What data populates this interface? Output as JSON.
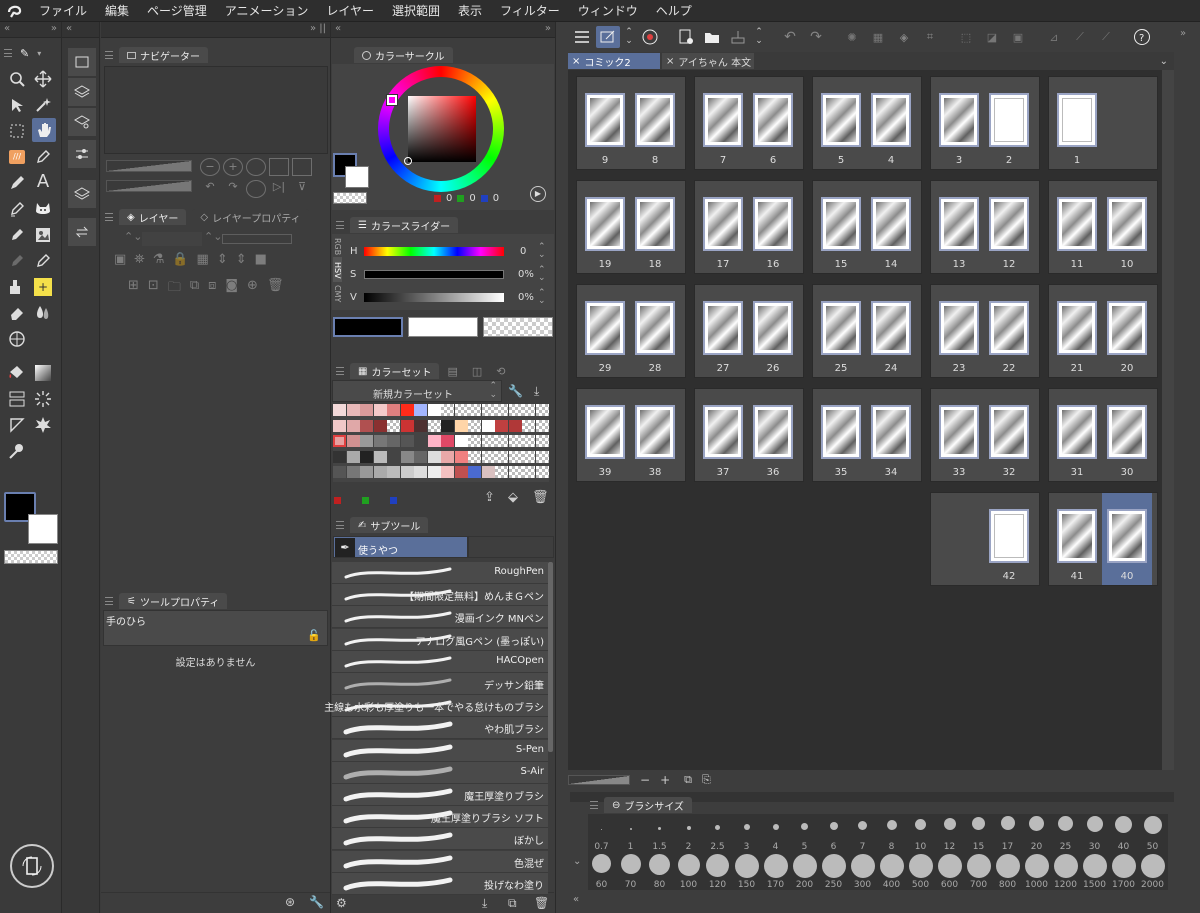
{
  "menubar": {
    "items": [
      "ファイル",
      "編集",
      "ページ管理",
      "アニメーション",
      "レイヤー",
      "選択範囲",
      "表示",
      "フィルター",
      "ウィンドウ",
      "ヘルプ"
    ]
  },
  "navigator": {
    "title": "ナビゲーター"
  },
  "layers": {
    "tab1": "レイヤー",
    "tab2": "レイヤープロパティ"
  },
  "tool_property": {
    "title": "ツールプロパティ",
    "tool_name": "手のひら",
    "empty_text": "設定はありません"
  },
  "color_circle": {
    "title": "カラーサークル",
    "r": "0",
    "g": "0",
    "b": "0"
  },
  "color_slider": {
    "title": "カラースライダー",
    "side_tabs": [
      "RGB",
      "HSV",
      "CMY"
    ],
    "h_label": "H",
    "h_value": "0",
    "s_label": "S",
    "s_value": "0%",
    "v_label": "V",
    "v_value": "0%"
  },
  "color_set": {
    "title": "カラーセット",
    "set_name": "新規カラーセット"
  },
  "subtool": {
    "title": "サブツール",
    "group": "使うやつ",
    "brushes": [
      "RoughPen",
      "【期間限定無料】めんまＧペン",
      "漫画インク MNペン",
      "アナログ風Gペン (墨っぽい)",
      "HACOpen",
      "デッサン鉛筆",
      "主線も水彩も厚塗りも一本でやる怠けものブラシ",
      "やわ肌ブラシ",
      "S-Pen",
      "S-Air",
      "魔王厚塗りブラシ",
      "魔王厚塗りブラシ ソフト",
      "ぼかし",
      "色混ぜ",
      "投げなわ塗り"
    ]
  },
  "document_tabs": [
    {
      "label": "コミック2",
      "active": true
    },
    {
      "label": "アイちゃん 本文",
      "active": false
    }
  ],
  "pages": {
    "rows": [
      [
        [
          "9",
          "8"
        ],
        [
          "7",
          "6"
        ],
        [
          "5",
          "4"
        ],
        [
          "3",
          "2"
        ],
        [
          "1"
        ]
      ],
      [
        [
          "19",
          "18"
        ],
        [
          "17",
          "16"
        ],
        [
          "15",
          "14"
        ],
        [
          "13",
          "12"
        ],
        [
          "11",
          "10"
        ]
      ],
      [
        [
          "29",
          "28"
        ],
        [
          "27",
          "26"
        ],
        [
          "25",
          "24"
        ],
        [
          "23",
          "22"
        ],
        [
          "21",
          "20"
        ]
      ],
      [
        [
          "39",
          "38"
        ],
        [
          "37",
          "36"
        ],
        [
          "35",
          "34"
        ],
        [
          "33",
          "32"
        ],
        [
          "31",
          "30"
        ]
      ],
      [
        [
          "42"
        ],
        [
          "41",
          "40"
        ]
      ]
    ],
    "selected": "40"
  },
  "zoom": {
    "minus": "−",
    "plus": "+"
  },
  "brush_size": {
    "title": "ブラシサイズ",
    "row1": [
      "0.7",
      "1",
      "1.5",
      "2",
      "2.5",
      "3",
      "4",
      "5",
      "6",
      "7",
      "8",
      "10",
      "12",
      "15",
      "17",
      "20",
      "25",
      "30",
      "40",
      "50"
    ],
    "row2": [
      "60",
      "70",
      "80",
      "100",
      "120",
      "150",
      "170",
      "200",
      "250",
      "300",
      "400",
      "500",
      "600",
      "700",
      "800",
      "1000",
      "1200",
      "1500",
      "1700",
      "2000"
    ]
  },
  "colors": {
    "main": "#000000",
    "sub": "#ffffff",
    "accent": "#5a6f9a",
    "palette": [
      "#f3d9d9",
      "#e8b8b8",
      "#d99a9a",
      "#f4c9c9",
      "#e07f7f",
      "#ff2b1a",
      "#a3b6ff",
      "#ffffff",
      "chk",
      "chk",
      "chk",
      "chk",
      "chk",
      "chk",
      "chk",
      "chk",
      "#f0c8c8",
      "#e0a8a8",
      "#b05050",
      "#8a3030",
      "chk",
      "#cc3333",
      "#4d3030",
      "chk",
      "#222222",
      "#ffd5a8",
      "chk",
      "#ffffff",
      "#c04040",
      "#b03838",
      "chk",
      "chk",
      "#e6a0a0",
      "#d09090",
      "#999999",
      "#777777",
      "#666666",
      "#555555",
      "#444444",
      "#ffb3c6",
      "#e04866",
      "#ffffff",
      "chk",
      "chk",
      "chk",
      "chk",
      "chk",
      "chk",
      "#333333",
      "#aaaaaa",
      "#222222",
      "#bbbbbb",
      "#444444",
      "#888888",
      "#666666",
      "#dddddd",
      "#e8a8a8",
      "#f08080",
      "chk",
      "chk",
      "chk",
      "chk",
      "chk",
      "chk",
      "#555555",
      "#777777",
      "#999999",
      "#aaaaaa",
      "#bbbbbb",
      "#cccccc",
      "#dddddd",
      "#eeeeee",
      "#f4c0c0",
      "#c05050",
      "#4a6ad0",
      "#d9c0c0",
      "chk",
      "chk",
      "chk",
      "chk"
    ]
  }
}
